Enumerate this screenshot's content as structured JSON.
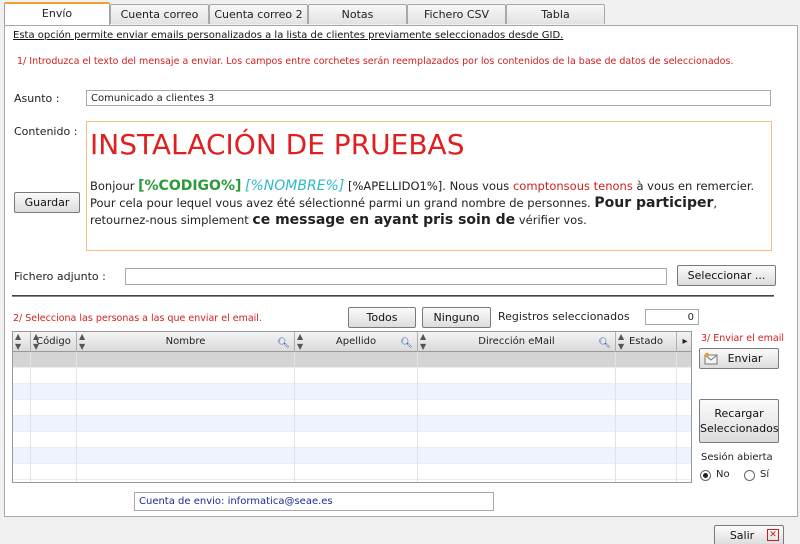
{
  "tabs": [
    {
      "label": "Envío"
    },
    {
      "label": "Cuenta correo"
    },
    {
      "label": "Cuenta correo 2"
    },
    {
      "label": "Notas"
    },
    {
      "label": "Fichero CSV"
    },
    {
      "label": "Tabla Seleccionados"
    }
  ],
  "intro_text": "Esta opción permite enviar emails personalizados a la lista de clientes previamente seleccionados desde GID.",
  "step1_text": "1/ Introduzca el texto del mensaje a enviar. Los campos entre corchetes serán reemplazados por los contenidos de la base de datos de seleccionados.",
  "asunto": {
    "label": "Asunto :",
    "value": "Comunicado a clientes 3"
  },
  "contenido": {
    "label": "Contenido :",
    "title": "INSTALACIÓN DE PRUEBAS",
    "body": {
      "p1": "Bonjour ",
      "code_tag": "[%CODIGO%]",
      "p2": " ",
      "name_tag": "[%NOMBRE%]",
      "p3": " [%APELLIDO1%]. Nous vous ",
      "red": "comptonsous tenons",
      "p4": " à vous en remercier. Pour cela pour lequel vous avez été sélectionné parmi un grand nombre de personnes. ",
      "bold1": "Pour participer",
      "p5": ", retournez-nous simplement ",
      "bold2": "ce message en ayant pris soin de",
      "p6": " vérifier vos."
    }
  },
  "guardar_button": "Guardar",
  "fichero": {
    "label": "Fichero adjunto :",
    "value": "",
    "button": "Seleccionar ..."
  },
  "step2_text": "2/ Selecciona las personas a las que enviar el email.",
  "todos_button": "Todos",
  "ninguno_button": "Ninguno",
  "registros": {
    "label": "Registros seleccionados",
    "value": "0"
  },
  "grid": {
    "columns": [
      "",
      "Código",
      "Nombre",
      "Apellido",
      "Dirección eMail",
      "Estado"
    ],
    "more_arrow": "▸"
  },
  "step3_text": "3/ Enviar el email",
  "enviar_button": "Enviar",
  "recargar_button": "Recargar Seleccionados",
  "sesion": {
    "label": "Sesión abierta",
    "no": "No",
    "si": "Sí",
    "selected": "No"
  },
  "cuenta_envio": "Cuenta de envio: informatica@seae.es",
  "salir_button": "Salir"
}
